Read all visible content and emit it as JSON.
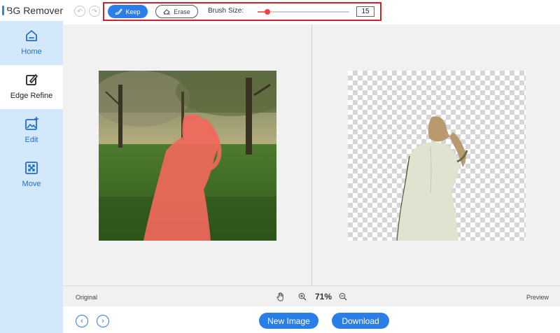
{
  "app": {
    "title": "BG Remover"
  },
  "sidebar": {
    "items": [
      {
        "label": "Home",
        "icon": "home-icon",
        "active": false
      },
      {
        "label": "Edge Refine",
        "icon": "edge-refine-icon",
        "active": true
      },
      {
        "label": "Edit",
        "icon": "edit-icon",
        "active": false
      },
      {
        "label": "Move",
        "icon": "move-icon",
        "active": false
      }
    ]
  },
  "toolbar": {
    "undo_icon": "undo-icon",
    "redo_icon": "redo-icon",
    "keep_label": "Keep",
    "erase_label": "Erase",
    "brush_size_label": "Brush Size:",
    "brush_size_value": "15",
    "brush_size_fraction": 0.11,
    "highlight_color": "#d3202a"
  },
  "canvas": {
    "original_label": "Original",
    "preview_label": "Preview",
    "zoom_text": "71%"
  },
  "footer": {
    "new_image_label": "New Image",
    "download_label": "Download"
  },
  "colors": {
    "accent": "#2b7ee8",
    "sidebar_bg": "#d4e8fb",
    "keep_mask": "#f0685c"
  }
}
